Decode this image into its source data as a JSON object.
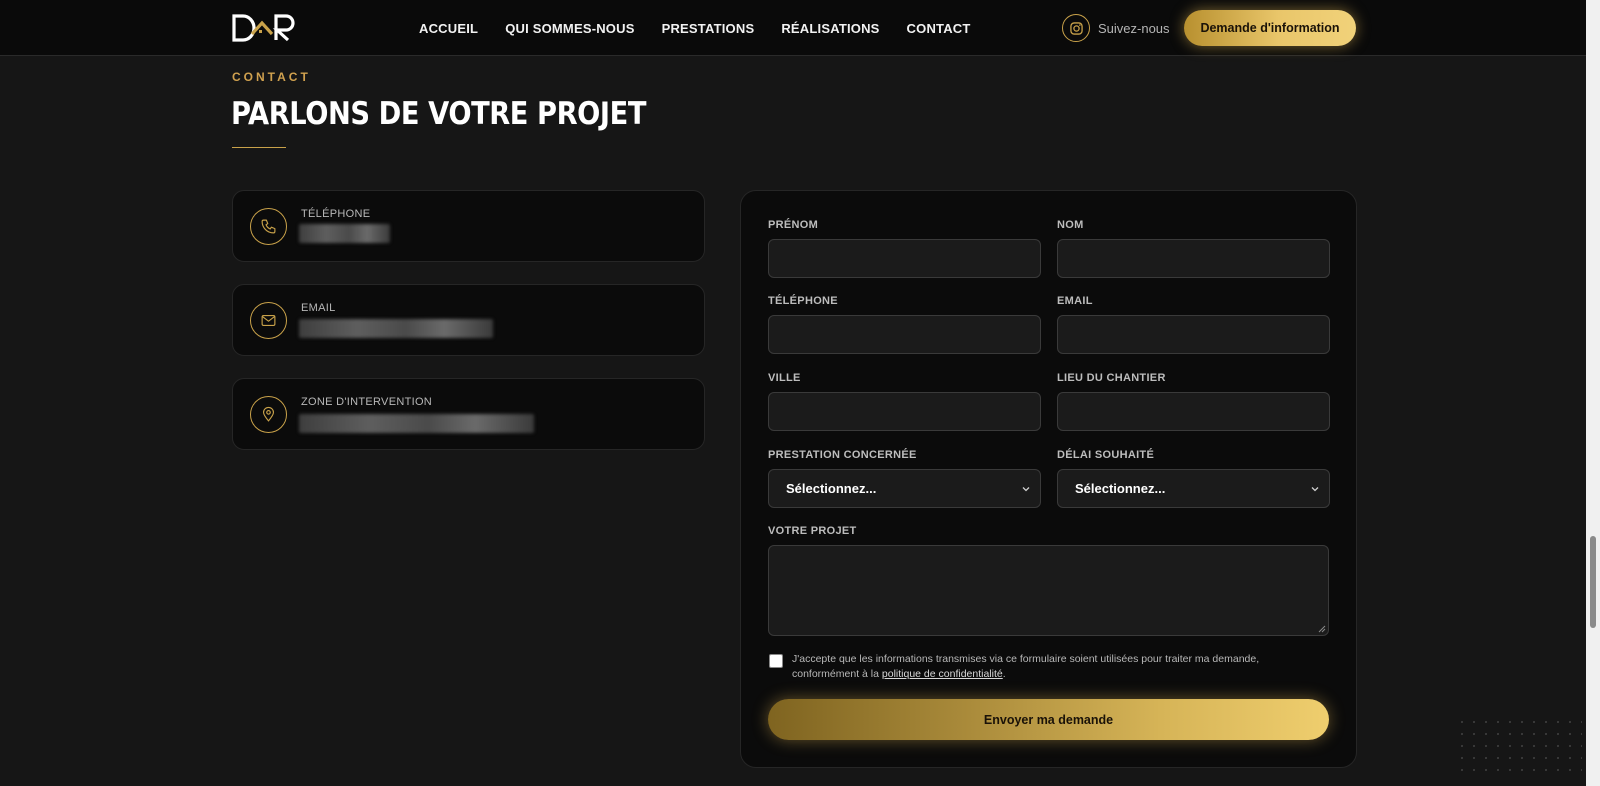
{
  "nav": {
    "logo_text": "DOR",
    "menu": [
      "ACCUEIL",
      "QUI SOMMES-NOUS",
      "PRESTATIONS",
      "RÉALISATIONS",
      "CONTACT"
    ],
    "follow_label": "Suivez-nous",
    "cta_label": "Demande d'information"
  },
  "section": {
    "eyebrow": "CONTACT",
    "title": "PARLONS DE VOTRE PROJET"
  },
  "info_cards": [
    {
      "label": "TÉLÉPHONE",
      "icon": "phone-icon"
    },
    {
      "label": "EMAIL",
      "icon": "mail-icon"
    },
    {
      "label": "ZONE D'INTERVENTION",
      "icon": "map-pin-icon"
    }
  ],
  "form": {
    "first_name_label": "PRÉNOM",
    "last_name_label": "NOM",
    "phone_label": "TÉLÉPHONE",
    "email_label": "EMAIL",
    "city_label": "VILLE",
    "site_label": "LIEU DU CHANTIER",
    "service_label": "PRESTATION CONCERNÉE",
    "service_value": "Sélectionnez...",
    "delay_label": "DÉLAI SOUHAITÉ",
    "delay_value": "Sélectionnez...",
    "project_label": "VOTRE PROJET",
    "consent_text": "J'accepte que les informations transmises via ce formulaire soient utilisées pour traiter ma demande, conformément à la ",
    "consent_link": "politique de confidentialité",
    "consent_end": ".",
    "submit_label": "Envoyer ma demande"
  },
  "colors": {
    "accent": "#c9a24a",
    "background": "#161616",
    "card": "#0b0b0b"
  }
}
